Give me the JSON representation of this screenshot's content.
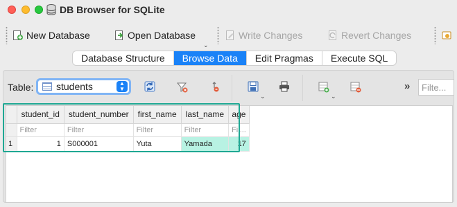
{
  "window": {
    "title": "DB Browser for SQLite"
  },
  "toolbar": {
    "new_database": "New Database",
    "open_database": "Open Database",
    "write_changes": "Write Changes",
    "revert_changes": "Revert Changes"
  },
  "tabs": [
    {
      "label": "Database Structure",
      "active": false
    },
    {
      "label": "Browse Data",
      "active": true
    },
    {
      "label": "Edit Pragmas",
      "active": false
    },
    {
      "label": "Execute SQL",
      "active": false
    }
  ],
  "browse": {
    "table_label": "Table:",
    "selected_table": "students",
    "filter_placeholder": "Filte...",
    "more_symbol": "»"
  },
  "grid": {
    "columns": [
      "student_id",
      "student_number",
      "first_name",
      "last_name",
      "age"
    ],
    "filters": [
      "Filter",
      "Filter",
      "Filter",
      "Filter",
      "Fil..."
    ],
    "rows": [
      {
        "rownum": "1",
        "cells": [
          "1",
          "S000001",
          "Yuta",
          "Yamada",
          "17"
        ]
      }
    ]
  },
  "colors": {
    "accent": "#1a82f7",
    "highlight_border": "#1fa893",
    "selected_cell": "#b8f2e3"
  }
}
